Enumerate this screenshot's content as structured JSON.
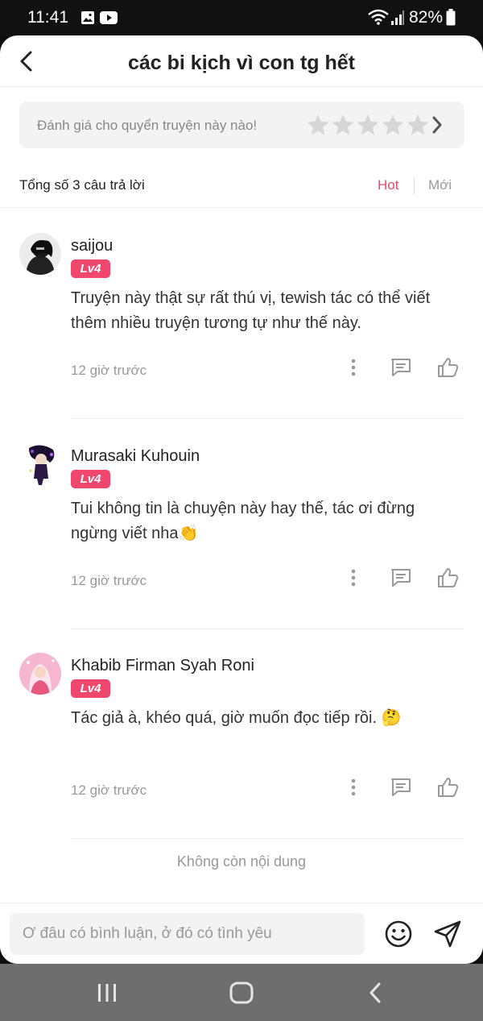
{
  "status_bar": {
    "time": "11:41",
    "battery": "82%"
  },
  "header": {
    "title": "các bi kịch vì con tg hết"
  },
  "rating": {
    "prompt": "Đánh giá cho quyển truyện này nào!",
    "stars": 5
  },
  "summary": {
    "count_text": "Tổng số 3 câu trả lời",
    "sort_hot": "Hot",
    "sort_new": "Mới"
  },
  "comments": [
    {
      "user": "saijou",
      "level": "Lv4",
      "text": "Truyện này thật sự rất thú vị, tewish tác có thể viết thêm nhiều truyện tương tự như thế này.",
      "time": "12 giờ trước"
    },
    {
      "user": "Murasaki Kuhouin",
      "level": "Lv4",
      "text": "Tui không tin là chuyện này hay thế, tác ơi đừng ngừng viết nha👏",
      "time": "12 giờ trước"
    },
    {
      "user": "Khabib Firman Syah Roni",
      "level": "Lv4",
      "text": "Tác giả à, khéo quá, giờ muốn đọc tiếp rồi. 🤔",
      "time": "12 giờ trước"
    }
  ],
  "footer_text": "Không còn nội dung",
  "input": {
    "placeholder": "Ơ đâu có bình luận, ở đó có tình yêu"
  },
  "colors": {
    "accent": "#f0476d",
    "hot": "#e84a6a"
  }
}
